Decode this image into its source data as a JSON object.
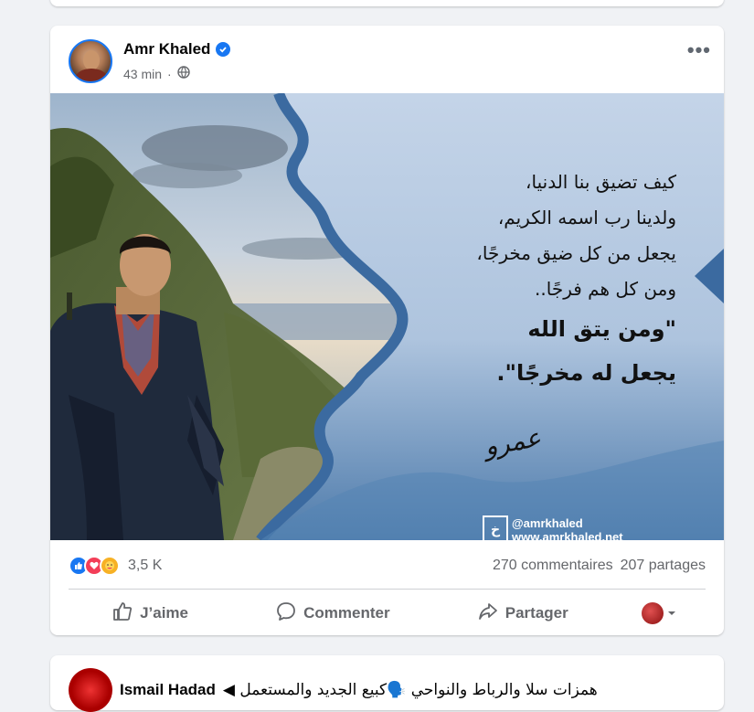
{
  "post": {
    "author": "Amr Khaled",
    "time": "43 min",
    "more_label": "•••",
    "image_text": {
      "lines": [
        "كيف تضيق بنا الدنيا،",
        "ولدينا رب اسمه الكريم،",
        "يجعل من كل ضيق مخرجًا،",
        "ومن كل هم فرجًا.."
      ],
      "bold_lines": [
        "\"ومن يتق الله",
        "يجعل له مخرجًا\"."
      ],
      "signature": "عمرو",
      "social_handle": "@amrkhaled",
      "site_url": "www.amrkhaled.net",
      "logo_glyph": "خ"
    },
    "reaction_count": "3,5 K",
    "comments": "270 commentaires",
    "shares": "207 partages",
    "actions": {
      "like": "J’aime",
      "comment": "Commenter",
      "share": "Partager"
    }
  },
  "next_post": {
    "author": "Ismail Hadad",
    "text": "همزات سلا والرباط والنواحي 🗣️كبيع الجديد والمستعمل ◀"
  },
  "colors": {
    "brand_blue": "#1877f2",
    "love": "#f33e58",
    "care": "#f7b125",
    "sky": "#bcd0e6",
    "frame": "#3b6aa0"
  },
  "icons": [
    "verified-icon",
    "globe-icon",
    "more-icon",
    "like-reaction-icon",
    "love-reaction-icon",
    "care-reaction-icon",
    "thumbs-up-icon",
    "comment-icon",
    "share-icon",
    "chevron-down-icon"
  ]
}
